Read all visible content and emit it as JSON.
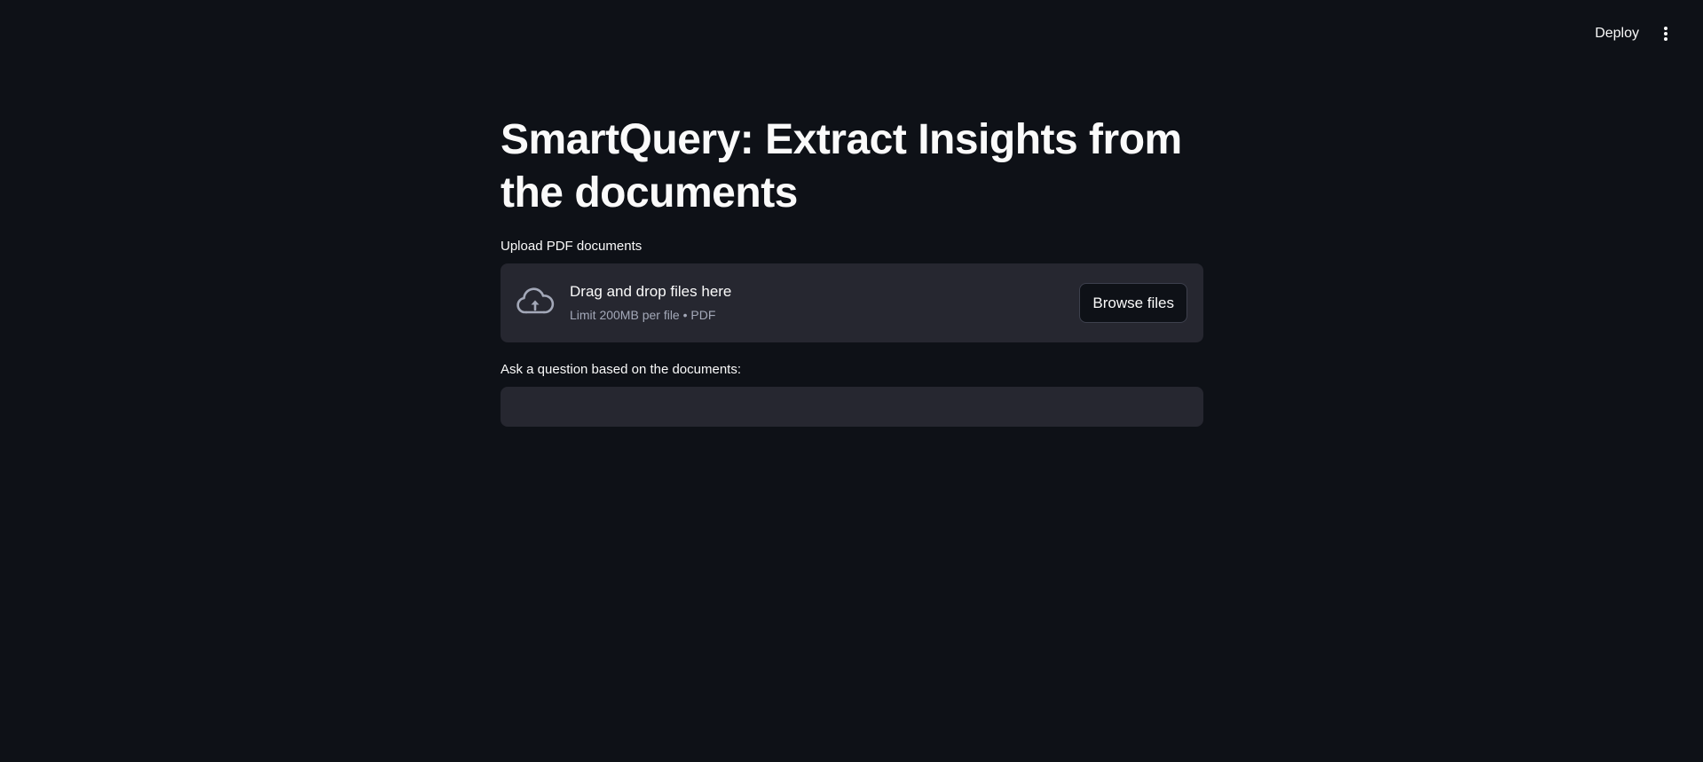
{
  "header": {
    "deploy_label": "Deploy",
    "menu_icon": "vertical-dots-icon"
  },
  "main": {
    "title": "SmartQuery: Extract Insights from the documents",
    "uploader": {
      "label": "Upload PDF documents",
      "drop_title": "Drag and drop files here",
      "drop_subtitle": "Limit 200MB per file • PDF",
      "browse_label": "Browse files",
      "icon": "cloud-upload-icon"
    },
    "question": {
      "label": "Ask a question based on the documents:",
      "value": ""
    }
  },
  "colors": {
    "background": "#0e1117",
    "widget_background": "#262730",
    "text": "#fafafa",
    "muted_text": "#a3a8b8"
  }
}
